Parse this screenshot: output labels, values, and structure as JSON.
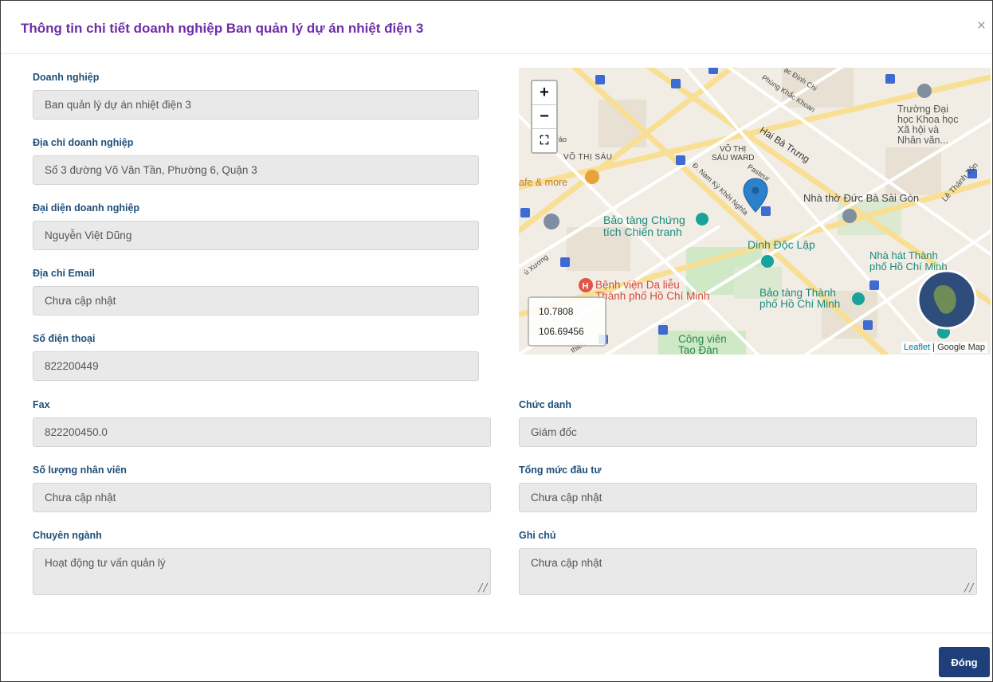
{
  "modal": {
    "title": "Thông tin chi tiết doanh nghiệp Ban quản lý dự án nhiệt điện 3",
    "close_icon": "×",
    "close_button_label": "Đóng"
  },
  "fields": {
    "company_label": "Doanh nghiệp",
    "company_value": "Ban quản lý dự án nhiệt điện 3",
    "address_label": "Địa chỉ doanh nghiệp",
    "address_value": "Số 3 đường Võ Văn Tần, Phường 6, Quận 3",
    "rep_label": "Đại diện doanh nghiệp",
    "rep_value": "Nguyễn Việt Dũng",
    "email_label": "Địa chỉ Email",
    "email_value": "Chưa cập nhật",
    "phone_label": "Số điện thoại",
    "phone_value": "822200449",
    "fax_label": "Fax",
    "fax_value": "822200450.0",
    "title_label": "Chức danh",
    "title_value": "Giám đốc",
    "staff_label": "Số lượng nhân viên",
    "staff_value": "Chưa cập nhật",
    "investment_label": "Tổng mức đầu tư",
    "investment_value": "Chưa cập nhật",
    "specialty_label": "Chuyên ngành",
    "specialty_value": "Hoạt động tư vấn quản lý",
    "note_label": "Ghi chú",
    "note_value": "Chưa cập nhật"
  },
  "map": {
    "zoom_in": "+",
    "zoom_out": "−",
    "fullscreen": "⛶",
    "lat": "10.7808",
    "lng": "106.69456",
    "attribution_link": "Leaflet",
    "attribution_sep": " | ",
    "attribution_provider": "Google Map",
    "labels": {
      "vo_thi_sau": "VÕ THỊ SÁU",
      "vo_thi_sau_ward_1": "VÕ THỊ",
      "vo_thi_sau_ward_2": "SÁU WARD",
      "hai_ba_trung": "Hai Bà Trưng",
      "phung_khac_khoan": "Phùng Khắc Khoan",
      "lac_dinh_chi": "ạc Đình Chi",
      "nam_ky_khoi_nghia": "Đ. Nam Kỳ Khởi Nghĩa",
      "pasteur": "Pasteur",
      "university_1": "Trường Đại",
      "university_2": "học Khoa học",
      "university_3": "Xã hội và",
      "university_4": "Nhân văn...",
      "cafe": "afe & more",
      "museum_war_1": "Bảo tàng Chứng",
      "museum_war_2": "tích Chiến tranh",
      "cathedral": "Nhà thờ Đức Bà Sài Gòn",
      "le_thanh_ton": "Lê Thánh Tôn",
      "independence_palace": "Dinh Độc Lập",
      "opera_1": "Nhà hát Thành",
      "opera_2": "phố Hồ Chí Minh",
      "hospital_1": "Bệnh viện Da liễu",
      "hospital_2": "Thành phố Hồ Chí Minh",
      "museum_city_1": "Bảo tàng Thành",
      "museum_city_2": "phố Hồ Chí Minh",
      "park_1": "Công viên",
      "park_2": "Tao Đàn",
      "tu_xuong": "ú Xương",
      "thieu": "thiều",
      "pao": "Pảo"
    }
  }
}
